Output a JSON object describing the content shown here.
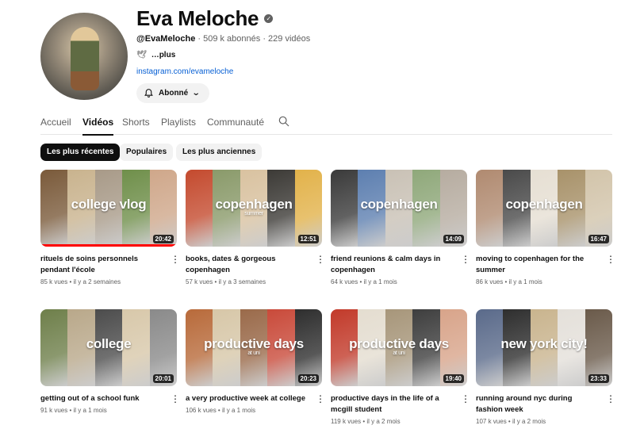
{
  "channel": {
    "name": "Eva Meloche",
    "handle": "@EvaMeloche",
    "stats": " · 509 k abonnés · 229 vidéos",
    "bio": "…plus",
    "link": "instagram.com/evameloche",
    "subscribe_label": "Abonné"
  },
  "tabs": [
    "Accueil",
    "Vidéos",
    "Shorts",
    "Playlists",
    "Communauté"
  ],
  "active_tab": "Vidéos",
  "chips": [
    "Les plus récentes",
    "Populaires",
    "Les plus anciennes"
  ],
  "active_chip": "Les plus récentes",
  "videos": [
    {
      "title": "rituels de soins personnels pendant l'école",
      "meta": "85 k vues • il y a 2 semaines",
      "duration": "20:42",
      "overlay": "college vlog",
      "overlay_sub": "",
      "progress": 1.0,
      "palette": [
        "#7a5a3a",
        "#c9b38e",
        "#a89a88",
        "#6f8f4a",
        "#cfa78a"
      ]
    },
    {
      "title": "books, dates & gorgeous copenhagen",
      "meta": "57 k vues • il y a 3 semaines",
      "duration": "12:51",
      "overlay": "copenhagen",
      "overlay_sub": "summer",
      "progress": 0,
      "palette": [
        "#c44a2e",
        "#8a9a6a",
        "#d9c2a0",
        "#3c3a36",
        "#e2b24a"
      ]
    },
    {
      "title": "friend reunions & calm days in copenhagen",
      "meta": "64 k vues • il y a 1 mois",
      "duration": "14:09",
      "overlay": "copenhagen",
      "overlay_sub": "",
      "progress": 0,
      "palette": [
        "#3a3a3a",
        "#5d7fb0",
        "#c9c1b5",
        "#8fa87a",
        "#b6aca0"
      ]
    },
    {
      "title": "moving to copenhagen for the summer",
      "meta": "86 k vues • il y a 1 mois",
      "duration": "16:47",
      "overlay": "copenhagen",
      "overlay_sub": "",
      "progress": 0,
      "palette": [
        "#b08a70",
        "#4a4a4a",
        "#e6dfd3",
        "#a8926a",
        "#d2c4aa"
      ]
    },
    {
      "title": "getting out of a school funk",
      "meta": "91 k vues • il y a 1 mois",
      "duration": "20:01",
      "overlay": "college",
      "overlay_sub": "",
      "progress": 0,
      "palette": [
        "#6e7f4a",
        "#b9a88a",
        "#4c4c4c",
        "#d8c8aa",
        "#8a8a8a"
      ]
    },
    {
      "title": "a very productive week at college",
      "meta": "106 k vues • il y a 1 mois",
      "duration": "20:23",
      "overlay": "productive days",
      "overlay_sub": "at uni",
      "progress": 0,
      "palette": [
        "#b86a3a",
        "#d7c7a8",
        "#9a6a4a",
        "#c94a3a",
        "#2e2e2e"
      ]
    },
    {
      "title": "productive days in the life of a mcgill student",
      "meta": "119 k vues • il y a 2 mois",
      "duration": "19:40",
      "overlay": "productive days",
      "overlay_sub": "at uni",
      "progress": 0,
      "palette": [
        "#c23a2a",
        "#e4ddd0",
        "#a7967a",
        "#3e3e3e",
        "#d8a48a"
      ]
    },
    {
      "title": "running around nyc during fashion week",
      "meta": "107 k vues • il y a 2 mois",
      "duration": "23:33",
      "overlay": "new york city!",
      "overlay_sub": "",
      "progress": 0,
      "palette": [
        "#5a6a8a",
        "#2e2e2e",
        "#c9b48e",
        "#e4e0da",
        "#6a5a4a"
      ]
    }
  ]
}
